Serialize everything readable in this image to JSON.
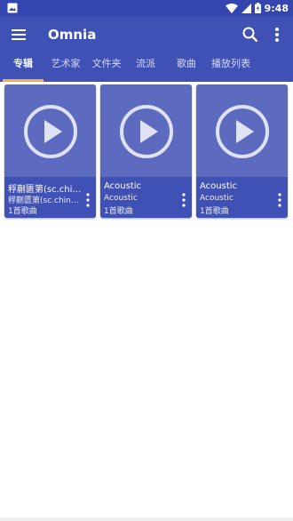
{
  "status_bar": {
    "time": "9:48",
    "icons": [
      "image-notification-icon",
      "wifi-icon",
      "signal-icon",
      "battery-icon"
    ]
  },
  "app_bar": {
    "title": "Omnia",
    "icons": [
      "menu-icon",
      "search-icon",
      "more-vert-icon"
    ]
  },
  "tabs": [
    {
      "label": "专辑",
      "active": true
    },
    {
      "label": "艺术家",
      "active": false
    },
    {
      "label": "文件夹",
      "active": false
    },
    {
      "label": "流派",
      "active": false
    },
    {
      "label": "歌曲",
      "active": false
    },
    {
      "label": "播放列表",
      "active": false
    }
  ],
  "albums": [
    {
      "name": "稃蒯匮第(sc.chinaz.com)",
      "artist": "稃蒯匮第(sc.chinaz.com)",
      "count": "1首歌曲"
    },
    {
      "name": "Acoustic",
      "artist": "Acoustic",
      "count": "1首歌曲"
    },
    {
      "name": "Acoustic",
      "artist": "Acoustic",
      "count": "1首歌曲"
    }
  ],
  "colors": {
    "primary": "#3f51b5",
    "status_bar": "#3545b0",
    "accent": "#ffab40",
    "card_art": "#5c6bc0"
  }
}
